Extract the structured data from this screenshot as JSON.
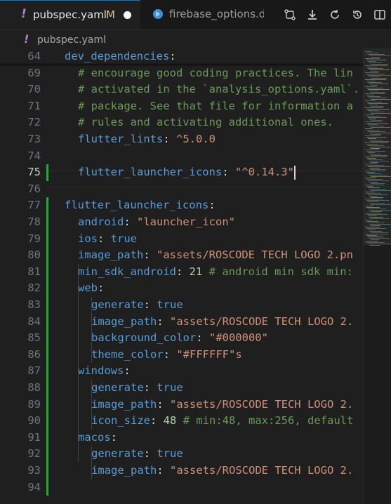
{
  "tabs": [
    {
      "label": "pubspec.yaml",
      "modified": "M",
      "active": true,
      "icon": "yaml-exclamation-icon"
    },
    {
      "label": "firebase_options.da",
      "active": false,
      "icon": "dart-icon"
    }
  ],
  "toolbar": {
    "actions": [
      "source-control-compare-icon",
      "download-icon",
      "refresh-icon",
      "history-icon",
      "split-editor-icon",
      "more-actions-icon"
    ]
  },
  "breadcrumb": {
    "file": "pubspec.yaml"
  },
  "editor": {
    "current_line": 75,
    "lines": [
      {
        "num": "64",
        "parts": [
          [
            "k",
            "dev_dependencies"
          ],
          [
            "p",
            ":"
          ]
        ],
        "indent": 0
      },
      {
        "num": "69",
        "parts": [
          [
            "c",
            "# encourage good coding practices. The lin"
          ]
        ],
        "indent": 1
      },
      {
        "num": "70",
        "parts": [
          [
            "c",
            "# activated in the `analysis_options.yaml`."
          ]
        ],
        "indent": 1
      },
      {
        "num": "71",
        "parts": [
          [
            "c",
            "# package. See that file for information a"
          ]
        ],
        "indent": 1
      },
      {
        "num": "72",
        "parts": [
          [
            "c",
            "# rules and activating additional ones."
          ]
        ],
        "indent": 1
      },
      {
        "num": "73",
        "parts": [
          [
            "k",
            "flutter_lints"
          ],
          [
            "p",
            ": "
          ],
          [
            "s",
            "^5.0.0"
          ]
        ],
        "indent": 1
      },
      {
        "num": "74",
        "parts": [],
        "indent": 0
      },
      {
        "num": "75",
        "parts": [
          [
            "k",
            "flutter_launcher_icons"
          ],
          [
            "p",
            ": "
          ],
          [
            "s",
            "\"^0.14.3\""
          ]
        ],
        "indent": 1
      },
      {
        "num": "76",
        "parts": [],
        "indent": 0
      },
      {
        "num": "77",
        "parts": [
          [
            "k",
            "flutter_launcher_icons"
          ],
          [
            "p",
            ":"
          ]
        ],
        "indent": 0
      },
      {
        "num": "78",
        "parts": [
          [
            "k",
            "android"
          ],
          [
            "p",
            ": "
          ],
          [
            "s",
            "\"launcher_icon\""
          ]
        ],
        "indent": 1
      },
      {
        "num": "79",
        "parts": [
          [
            "k",
            "ios"
          ],
          [
            "p",
            ": "
          ],
          [
            "k",
            "true"
          ]
        ],
        "indent": 1
      },
      {
        "num": "80",
        "parts": [
          [
            "k",
            "image_path"
          ],
          [
            "p",
            ": "
          ],
          [
            "s",
            "\"assets/ROSCODE TECH LOGO 2.pn"
          ]
        ],
        "indent": 1
      },
      {
        "num": "81",
        "parts": [
          [
            "k",
            "min_sdk_android"
          ],
          [
            "p",
            ": "
          ],
          [
            "n",
            "21"
          ],
          [
            "p",
            " "
          ],
          [
            "c",
            "# android min sdk min:"
          ]
        ],
        "indent": 1
      },
      {
        "num": "82",
        "parts": [
          [
            "k",
            "web"
          ],
          [
            "p",
            ":"
          ]
        ],
        "indent": 1
      },
      {
        "num": "83",
        "parts": [
          [
            "k",
            "generate"
          ],
          [
            "p",
            ": "
          ],
          [
            "k",
            "true"
          ]
        ],
        "indent": 2
      },
      {
        "num": "84",
        "parts": [
          [
            "k",
            "image_path"
          ],
          [
            "p",
            ": "
          ],
          [
            "s",
            "\"assets/ROSCODE TECH LOGO 2."
          ]
        ],
        "indent": 2
      },
      {
        "num": "85",
        "parts": [
          [
            "k",
            "background_color"
          ],
          [
            "p",
            ": "
          ],
          [
            "s",
            "\"#000000\""
          ]
        ],
        "indent": 2
      },
      {
        "num": "86",
        "parts": [
          [
            "k",
            "theme_color"
          ],
          [
            "p",
            ": "
          ],
          [
            "s",
            "\"#FFFFFF\"s"
          ]
        ],
        "indent": 2
      },
      {
        "num": "87",
        "parts": [
          [
            "k",
            "windows"
          ],
          [
            "p",
            ":"
          ]
        ],
        "indent": 1
      },
      {
        "num": "88",
        "parts": [
          [
            "k",
            "generate"
          ],
          [
            "p",
            ": "
          ],
          [
            "k",
            "true"
          ]
        ],
        "indent": 2
      },
      {
        "num": "89",
        "parts": [
          [
            "k",
            "image_path"
          ],
          [
            "p",
            ": "
          ],
          [
            "s",
            "\"assets/ROSCODE TECH LOGO 2."
          ]
        ],
        "indent": 2
      },
      {
        "num": "90",
        "parts": [
          [
            "k",
            "icon_size"
          ],
          [
            "p",
            ": "
          ],
          [
            "n",
            "48"
          ],
          [
            "p",
            " "
          ],
          [
            "c",
            "# min:48, max:256, default"
          ]
        ],
        "indent": 2
      },
      {
        "num": "91",
        "parts": [
          [
            "k",
            "macos"
          ],
          [
            "p",
            ":"
          ]
        ],
        "indent": 1
      },
      {
        "num": "92",
        "parts": [
          [
            "k",
            "generate"
          ],
          [
            "p",
            ": "
          ],
          [
            "k",
            "true"
          ]
        ],
        "indent": 2
      },
      {
        "num": "93",
        "parts": [
          [
            "k",
            "image_path"
          ],
          [
            "p",
            ": "
          ],
          [
            "s",
            "\"assets/ROSCODE TECH LOGO 2."
          ]
        ],
        "indent": 2
      },
      {
        "num": "94",
        "parts": [],
        "indent": 0
      }
    ]
  },
  "colors": {
    "keyword": "#569cd6",
    "string": "#ce9178",
    "comment": "#6a9955",
    "number": "#b5cea8",
    "modified_gutter": "#2ea043",
    "yaml_icon": "#b180d7"
  }
}
